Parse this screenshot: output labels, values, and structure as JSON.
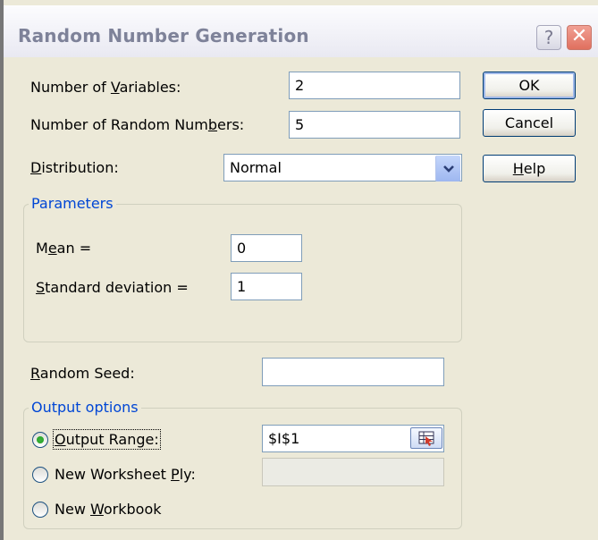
{
  "dialog": {
    "title": "Random Number Generation"
  },
  "titlebar": {
    "help_glyph": "?",
    "close_glyph": "✕"
  },
  "fields": {
    "num_variables": {
      "label_pre": "Number of ",
      "label_key": "V",
      "label_post": "ariables:",
      "value": "2"
    },
    "num_random": {
      "label_pre": "Number of Random Num",
      "label_key": "b",
      "label_post": "ers:",
      "value": "5"
    },
    "distribution": {
      "label_pre": "",
      "label_key": "D",
      "label_post": "istribution:",
      "value": "Normal"
    }
  },
  "buttons": {
    "ok": "OK",
    "cancel": "Cancel",
    "help_key": "H",
    "help_post": "elp"
  },
  "parameters": {
    "legend": "Parameters",
    "mean": {
      "label_pre": "M",
      "label_key": "e",
      "label_post": "an =",
      "value": "0"
    },
    "std": {
      "label_pre": "",
      "label_key": "S",
      "label_post": "tandard deviation =",
      "value": "1"
    }
  },
  "random_seed": {
    "label_pre": "",
    "label_key": "R",
    "label_post": "andom Seed:",
    "value": ""
  },
  "output": {
    "legend": "Output options",
    "output_range": {
      "label_pre": "",
      "label_key": "O",
      "label_post": "utput Range:",
      "value": "$I$1",
      "selected": true
    },
    "new_worksheet": {
      "label_pre": "New Worksheet ",
      "label_key": "P",
      "label_post": "ly:",
      "value": "",
      "selected": false
    },
    "new_workbook": {
      "label_pre": "New ",
      "label_key": "W",
      "label_post": "orkbook",
      "selected": false
    }
  },
  "icons": {
    "dropdown": "chevron-down-icon",
    "range_picker": "range-select-icon"
  },
  "colors": {
    "dialog_bg": "#ece9d8",
    "group_legend": "#0046d5",
    "radio_selected": "#21a121",
    "input_border": "#7f9db9"
  }
}
